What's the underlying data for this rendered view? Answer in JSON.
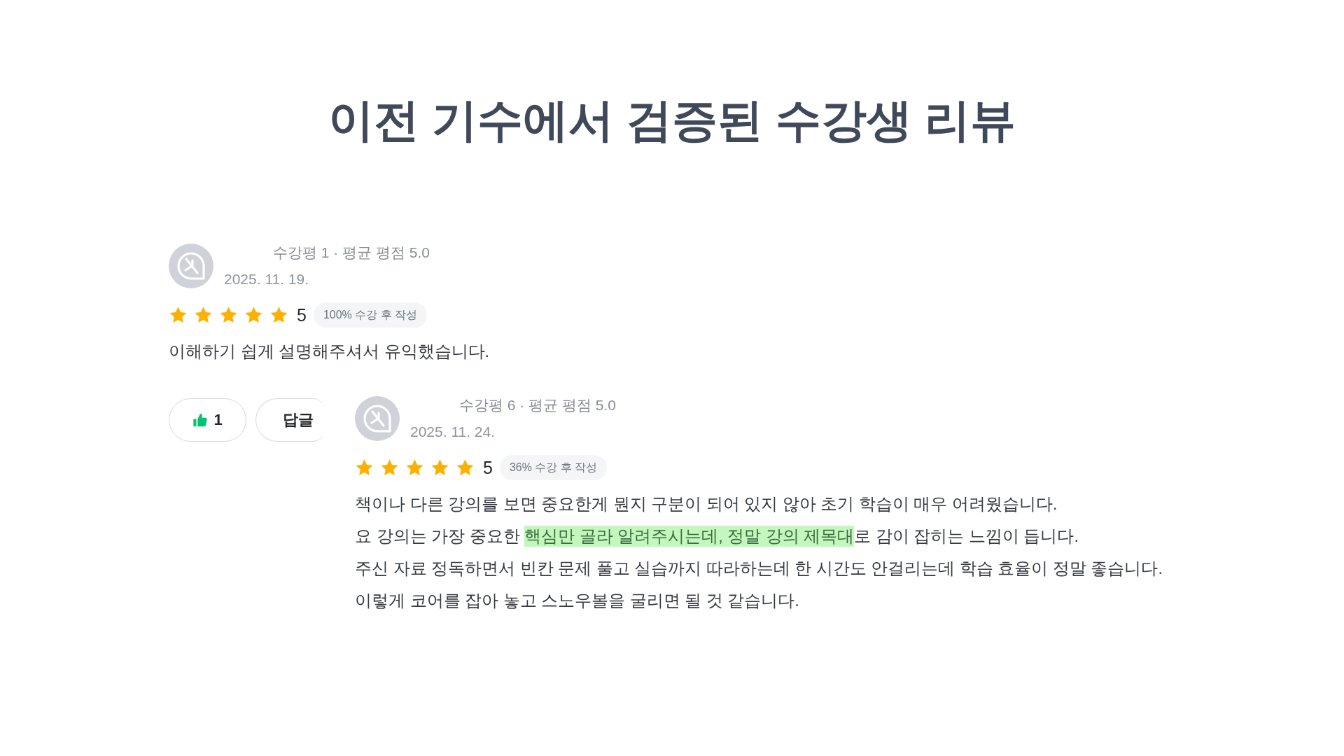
{
  "title": "이전 기수에서 검증된 수강생 리뷰",
  "reviews": [
    {
      "meta": "수강평 1 · 평균 평점 5.0",
      "date": "2025. 11. 19.",
      "stars": 5,
      "rating": "5",
      "badge": "100% 수강 후 작성",
      "lines": [
        [
          {
            "text": "이해하기 쉽게 설명해주셔서 유익했습니다.",
            "highlighted": false
          }
        ]
      ],
      "actions": [
        {
          "kind": "like",
          "label": "1"
        },
        {
          "kind": "reply",
          "label": "답글"
        }
      ]
    },
    {
      "meta": "수강평 6 · 평균 평점 5.0",
      "date": "2025. 11. 24.",
      "stars": 5,
      "rating": "5",
      "badge": "36% 수강 후 작성",
      "lines": [
        [
          {
            "text": "책이나 다른 강의를 보면 중요한게 뭔지 구분이 되어 있지 않아 초기 학습이 매우 어려웠습니다.",
            "highlighted": false
          }
        ],
        [
          {
            "text": "요 강의는 가장 중요한 ",
            "highlighted": false
          },
          {
            "text": "핵심만 골라 알려주시는데, 정말 강의 제목대",
            "highlighted": true
          },
          {
            "text": "로 감이 잡히는 느낌이 듭니다.",
            "highlighted": false
          }
        ],
        [
          {
            "text": "주신 자료 정독하면서 빈칸 문제 풀고 실습까지 따라하는데 한 시간도 안걸리는데 학습 효율이 정말 좋습니다.",
            "highlighted": false
          }
        ],
        [
          {
            "text": "이렇게 코어를 잡아 놓고 스노우볼을 굴리면 될 것 같습니다.",
            "highlighted": false
          }
        ]
      ]
    }
  ]
}
